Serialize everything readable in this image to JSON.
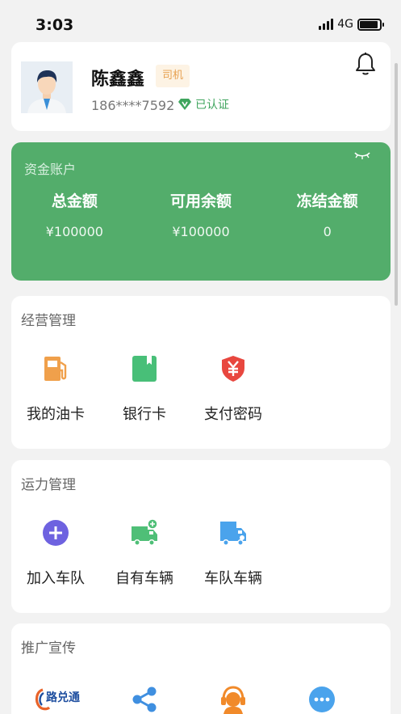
{
  "status_bar": {
    "time": "3:03",
    "network": "4G",
    "battery_level": 0.9
  },
  "profile": {
    "name": "陈鑫鑫",
    "role": "司机",
    "phone": "186****7592",
    "verified_label": "已认证"
  },
  "account": {
    "title": "资金账户",
    "items": [
      {
        "label": "总金额",
        "value": "¥100000"
      },
      {
        "label": "可用余额",
        "value": "¥100000"
      },
      {
        "label": "冻结金额",
        "value": "0"
      }
    ]
  },
  "business": {
    "title": "经营管理",
    "items": [
      {
        "label": "我的油卡",
        "icon": "fuel-card-icon"
      },
      {
        "label": "银行卡",
        "icon": "bank-card-icon"
      },
      {
        "label": "支付密码",
        "icon": "yuan-shield-icon"
      }
    ]
  },
  "capacity": {
    "title": "运力管理",
    "items": [
      {
        "label": "加入车队",
        "icon": "plus-circle-icon"
      },
      {
        "label": "自有车辆",
        "icon": "own-truck-icon"
      },
      {
        "label": "车队车辆",
        "icon": "fleet-truck-icon"
      }
    ]
  },
  "promotion": {
    "title": "推广宣传",
    "logo_text": "路兑通",
    "items": [
      "lu-dui-tong-logo",
      "share-icon",
      "customer-service-icon",
      "more-icon"
    ]
  },
  "colors": {
    "account_green": "#53ad6b",
    "fuel_orange": "#f0a04b",
    "card_green": "#48bf78",
    "shield_red": "#e8473f",
    "purple": "#6e62e0",
    "truck_green": "#4fbf77",
    "truck_blue": "#4aa3ec",
    "share_blue": "#3f8fe0",
    "headset_orange": "#f18a2a"
  }
}
